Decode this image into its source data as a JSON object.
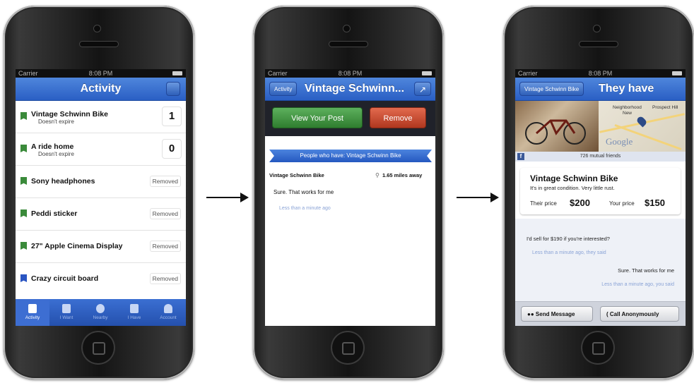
{
  "status": {
    "carrier": "Carrier",
    "time": "8:08 PM"
  },
  "screen1": {
    "title": "Activity",
    "items": [
      {
        "name": "Vintage Schwinn Bike",
        "sub": "Doesn't expire",
        "count": "1"
      },
      {
        "name": "A ride home",
        "sub": "Doesn't expire",
        "count": "0"
      },
      {
        "name": "Sony headphones",
        "status": "Removed"
      },
      {
        "name": "Peddi sticker",
        "status": "Removed"
      },
      {
        "name": "27\" Apple Cinema Display",
        "status": "Removed"
      },
      {
        "name": "Crazy circuit board",
        "status": "Removed"
      }
    ],
    "tabs": [
      {
        "label": "Activity",
        "icon": "inbox-icon"
      },
      {
        "label": "I Want",
        "icon": "flag-icon"
      },
      {
        "label": "Nearby",
        "icon": "location-icon"
      },
      {
        "label": "I Have",
        "icon": "tag-icon"
      },
      {
        "label": "Account",
        "icon": "person-icon"
      }
    ]
  },
  "screen2": {
    "back_label": "Activity",
    "title": "Vintage Schwinn...",
    "view_post_label": "View Your Post",
    "remove_label": "Remove",
    "ribbon": "People who have: Vintage Schwinn Bike",
    "item_name": "Vintage Schwinn Bike",
    "distance": "1.65 miles away",
    "message": "Sure. That works for me",
    "timestamp": "Less than a minute ago"
  },
  "screen3": {
    "back_label": "Vintage Schwinn Bike",
    "title": "They have",
    "map_labels": {
      "n1": "Neighborhood",
      "n2": "New",
      "n3": "Prospect Hill",
      "google": "Google"
    },
    "mutual_friends": "726 mutual friends",
    "item_title": "Vintage Schwinn Bike",
    "description": "It's in great condition. Very little rust.",
    "their_price_label": "Their price",
    "their_price": "$200",
    "your_price_label": "Your price",
    "your_price": "$150",
    "msg1": "I'd sell for $190 if you're interested?",
    "msg1_time": "Less than a minute ago, they said",
    "msg2": "Sure. That works for me",
    "msg2_time": "Less than a minute ago, you said",
    "send_label": "Send Message",
    "call_label": "Call Anonymously"
  },
  "colors": {
    "nav_blue": "#2a5fc4",
    "green": "#3a8a3a",
    "red": "#b0371f"
  }
}
